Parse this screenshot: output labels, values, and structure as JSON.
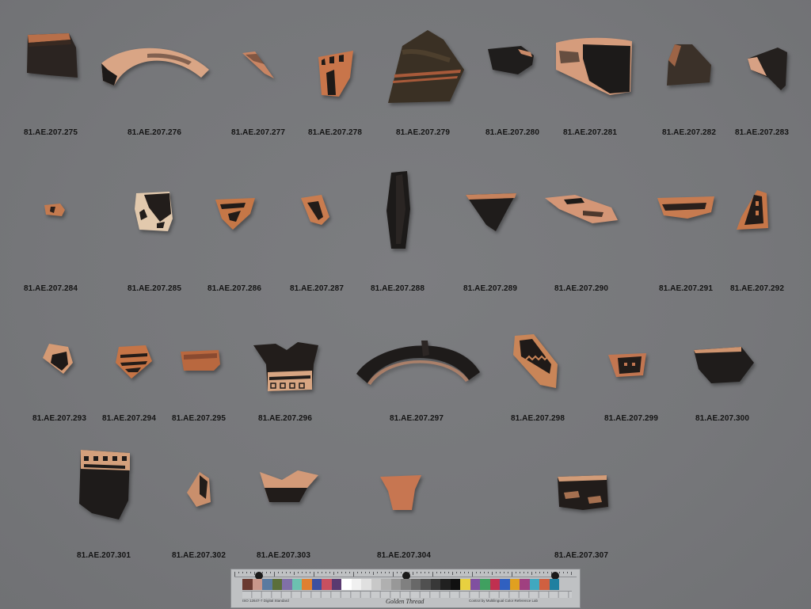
{
  "labels": {
    "r1": [
      "81.AE.207.275",
      "81.AE.207.276",
      "81.AE.207.277",
      "81.AE.207.278",
      "81.AE.207.279",
      "81.AE.207.280",
      "81.AE.207.281",
      "81.AE.207.282",
      "81.AE.207.283"
    ],
    "r2": [
      "81.AE.207.284",
      "81.AE.207.285",
      "81.AE.207.286",
      "81.AE.207.287",
      "81.AE.207.288",
      "81.AE.207.289",
      "81.AE.207.290",
      "81.AE.207.291",
      "81.AE.207.292"
    ],
    "r3": [
      "81.AE.207.293",
      "81.AE.207.294",
      "81.AE.207.295",
      "81.AE.207.296",
      "81.AE.207.297",
      "81.AE.207.298",
      "81.AE.207.299",
      "81.AE.207.300"
    ],
    "r4": [
      "81.AE.207.301",
      "81.AE.207.302",
      "81.AE.207.303",
      "81.AE.207.304",
      "81.AE.207.307"
    ]
  },
  "colors": {
    "background": "#76777a",
    "black_gloss": "#1e1c1b",
    "terracotta": "#c07a52",
    "terracotta_light": "#d8a07e"
  },
  "color_card": {
    "brand": "Golden Thread",
    "left_note": "ISO 12647-7 Digital Standard",
    "right_note": "Control by Multilingual Color Reference Lab",
    "patches": [
      "#6a3a30",
      "#c9978a",
      "#5a7aa0",
      "#5b6f3a",
      "#8070a8",
      "#6cc0b0",
      "#e08030",
      "#3c50a0",
      "#c85060",
      "#5a3a70",
      "#ffffff",
      "#f0f0f0",
      "#e0e0e0",
      "#c8c8c8",
      "#b0b0b0",
      "#989898",
      "#808080",
      "#686868",
      "#505050",
      "#383838",
      "#202020",
      "#101010",
      "#e8d040",
      "#8050a0",
      "#40a060",
      "#c03050",
      "#3060c0",
      "#e0a020",
      "#a04080",
      "#40a8c0",
      "#d06040",
      "#2080a0"
    ]
  }
}
